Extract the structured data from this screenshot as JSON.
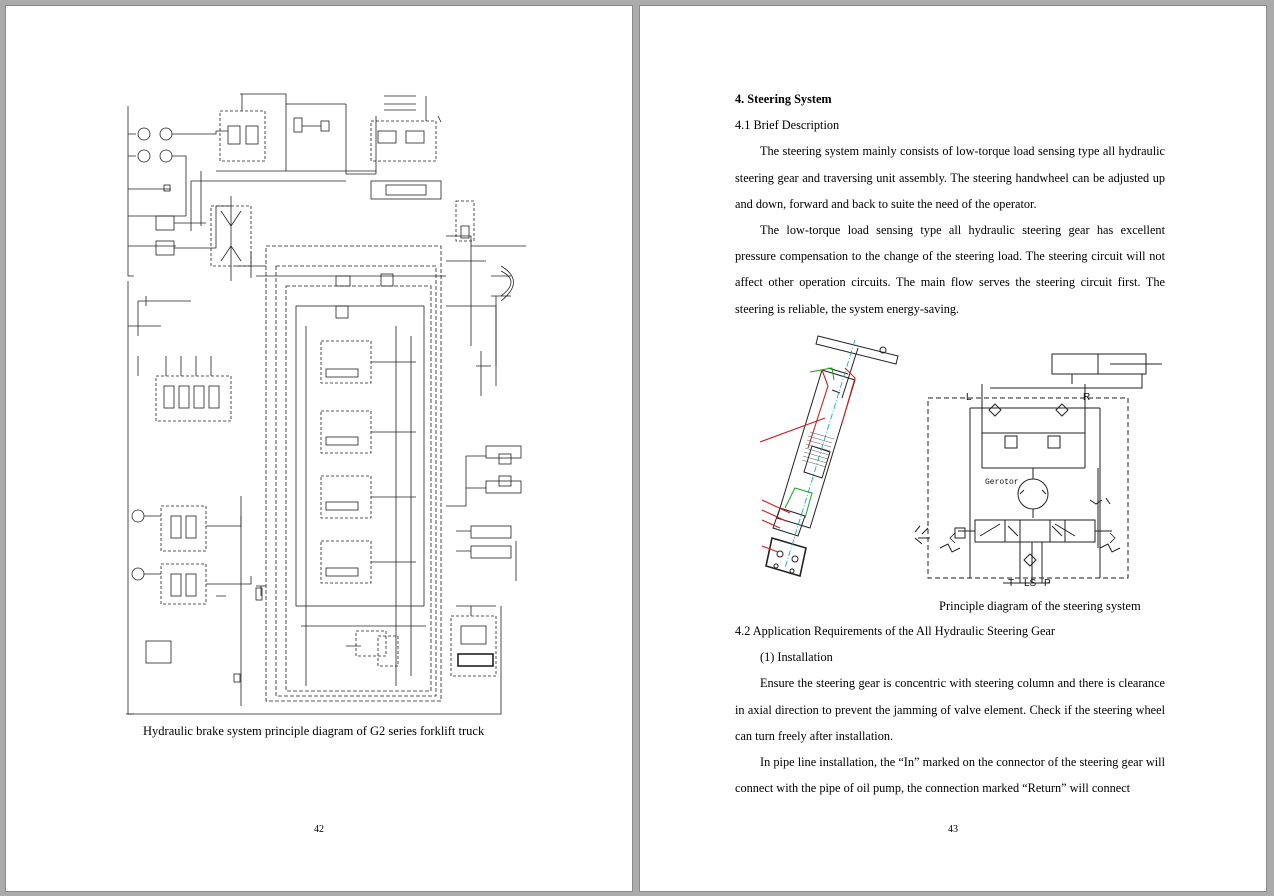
{
  "left_page": {
    "caption": "Hydraulic brake system principle diagram of G2 series forklift truck",
    "page_number": "42"
  },
  "right_page": {
    "heading": "4. Steering System",
    "subheading_1": "4.1 Brief Description",
    "para_1": "The steering system mainly consists of low-torque load sensing type all hydraulic steering gear and traversing unit assembly. The steering handwheel can be adjusted up and down, forward and back to suite the need of the operator.",
    "para_2": "The low-torque load sensing type all hydraulic steering gear has excellent pressure compensation to the change of the steering load. The steering circuit will not affect other operation circuits. The main flow serves the steering circuit first. The steering is reliable, the system energy-saving.",
    "figure_caption": "Principle diagram of the steering system",
    "schematic_labels": {
      "left_port": "L",
      "right_port": "R",
      "gerotor": "Gerotor",
      "t_port": "T",
      "ls_port": "LS",
      "p_port": "P"
    },
    "subheading_2": "4.2 Application Requirements of the All Hydraulic Steering Gear",
    "item_1": "(1) Installation",
    "para_3": "Ensure the steering gear is concentric with steering column and there is clearance in axial direction to prevent the jamming of valve element. Check if the steering wheel can turn freely after installation.",
    "para_4": "In pipe line installation, the “In” marked on the connector of the steering gear will connect with the pipe of oil pump, the connection marked “Return” will connect",
    "page_number": "43"
  }
}
